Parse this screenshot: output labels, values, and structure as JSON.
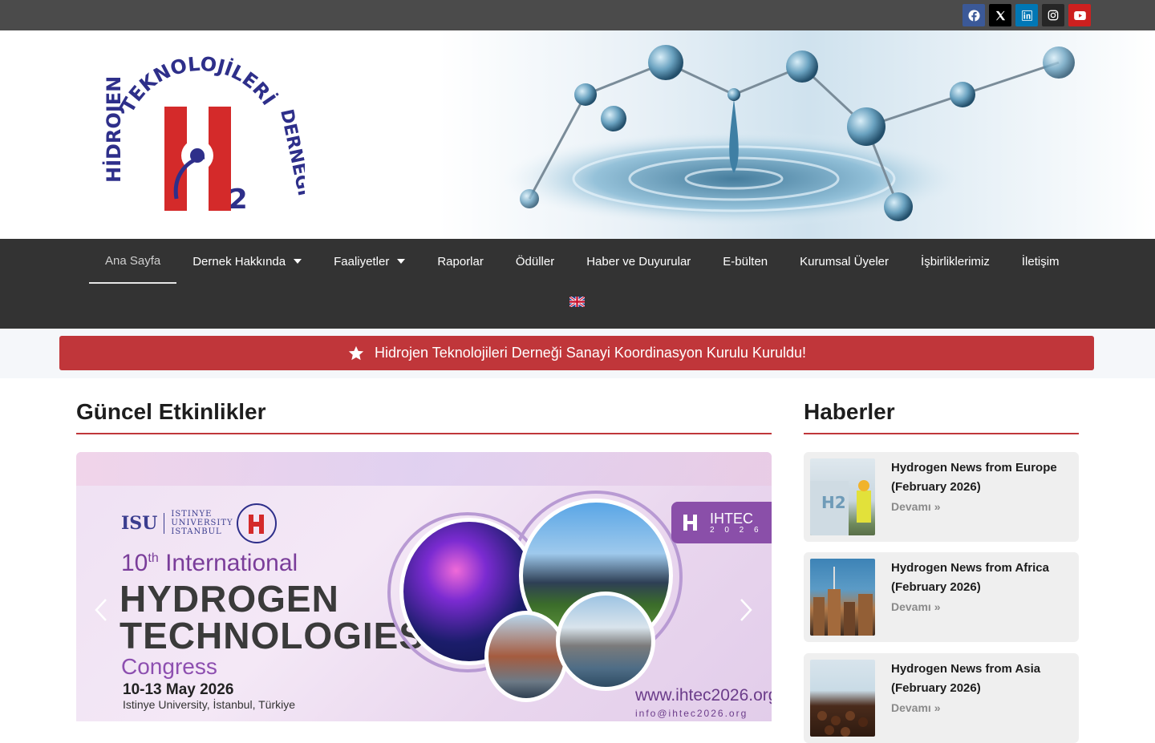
{
  "social": {
    "facebook": "facebook-icon",
    "x": "x-icon",
    "linkedin": "linkedin-icon",
    "instagram": "instagram-icon",
    "youtube": "youtube-icon"
  },
  "logo": {
    "arc_text": "TEKNOLOJİLERİ",
    "left_text": "HİDROJEN",
    "right_text": "DERNEĞİ",
    "h_letter": "H",
    "sub": "2"
  },
  "nav": {
    "items": [
      {
        "label": "Ana Sayfa",
        "active": true,
        "dropdown": false
      },
      {
        "label": "Dernek Hakkında",
        "active": false,
        "dropdown": true
      },
      {
        "label": "Faaliyetler",
        "active": false,
        "dropdown": true
      },
      {
        "label": "Raporlar",
        "active": false,
        "dropdown": false
      },
      {
        "label": "Ödüller",
        "active": false,
        "dropdown": false
      },
      {
        "label": "Haber ve Duyurular",
        "active": false,
        "dropdown": false
      },
      {
        "label": "E-bülten",
        "active": false,
        "dropdown": false
      },
      {
        "label": "Kurumsal Üyeler",
        "active": false,
        "dropdown": false
      },
      {
        "label": "İşbirliklerimiz",
        "active": false,
        "dropdown": false
      },
      {
        "label": "İletişim",
        "active": false,
        "dropdown": false
      }
    ],
    "language_flag": "uk-flag-icon"
  },
  "announcement": {
    "text": "Hidrojen Teknolojileri Derneği Sanayi Koordinasyon Kurulu Kuruldu!",
    "icon": "star-icon"
  },
  "events": {
    "heading": "Güncel Etkinlikler",
    "slide": {
      "isu": "ISU",
      "isu_line1": "ISTINYE",
      "isu_line2": "UNIVERSITY",
      "isu_line3": "ISTANBUL",
      "ordinal": "10",
      "ordinal_suffix": "th",
      "intl": "International",
      "line1": "HYDROGEN",
      "line2": "TECHNOLOGIES",
      "line3": "Congress",
      "dates": "10-13 May 2026",
      "venue": "Istinye University, İstanbul, Türkiye",
      "website": "www.ihtec2026.org",
      "email": "info@ihtec2026.org",
      "badge_title": "IHTEC",
      "badge_year": "2 0 2 6"
    }
  },
  "news": {
    "heading": "Haberler",
    "read_more": "Devamı »",
    "items": [
      {
        "title": "Hydrogen News from Europe (February 2026)"
      },
      {
        "title": "Hydrogen News from Africa (February 2026)"
      },
      {
        "title": "Hydrogen News from Asia (February 2026)"
      }
    ]
  },
  "colors": {
    "topbar": "#4b4b4b",
    "nav": "#333333",
    "accent_red": "#c0363a",
    "card_bg": "#efefef"
  }
}
